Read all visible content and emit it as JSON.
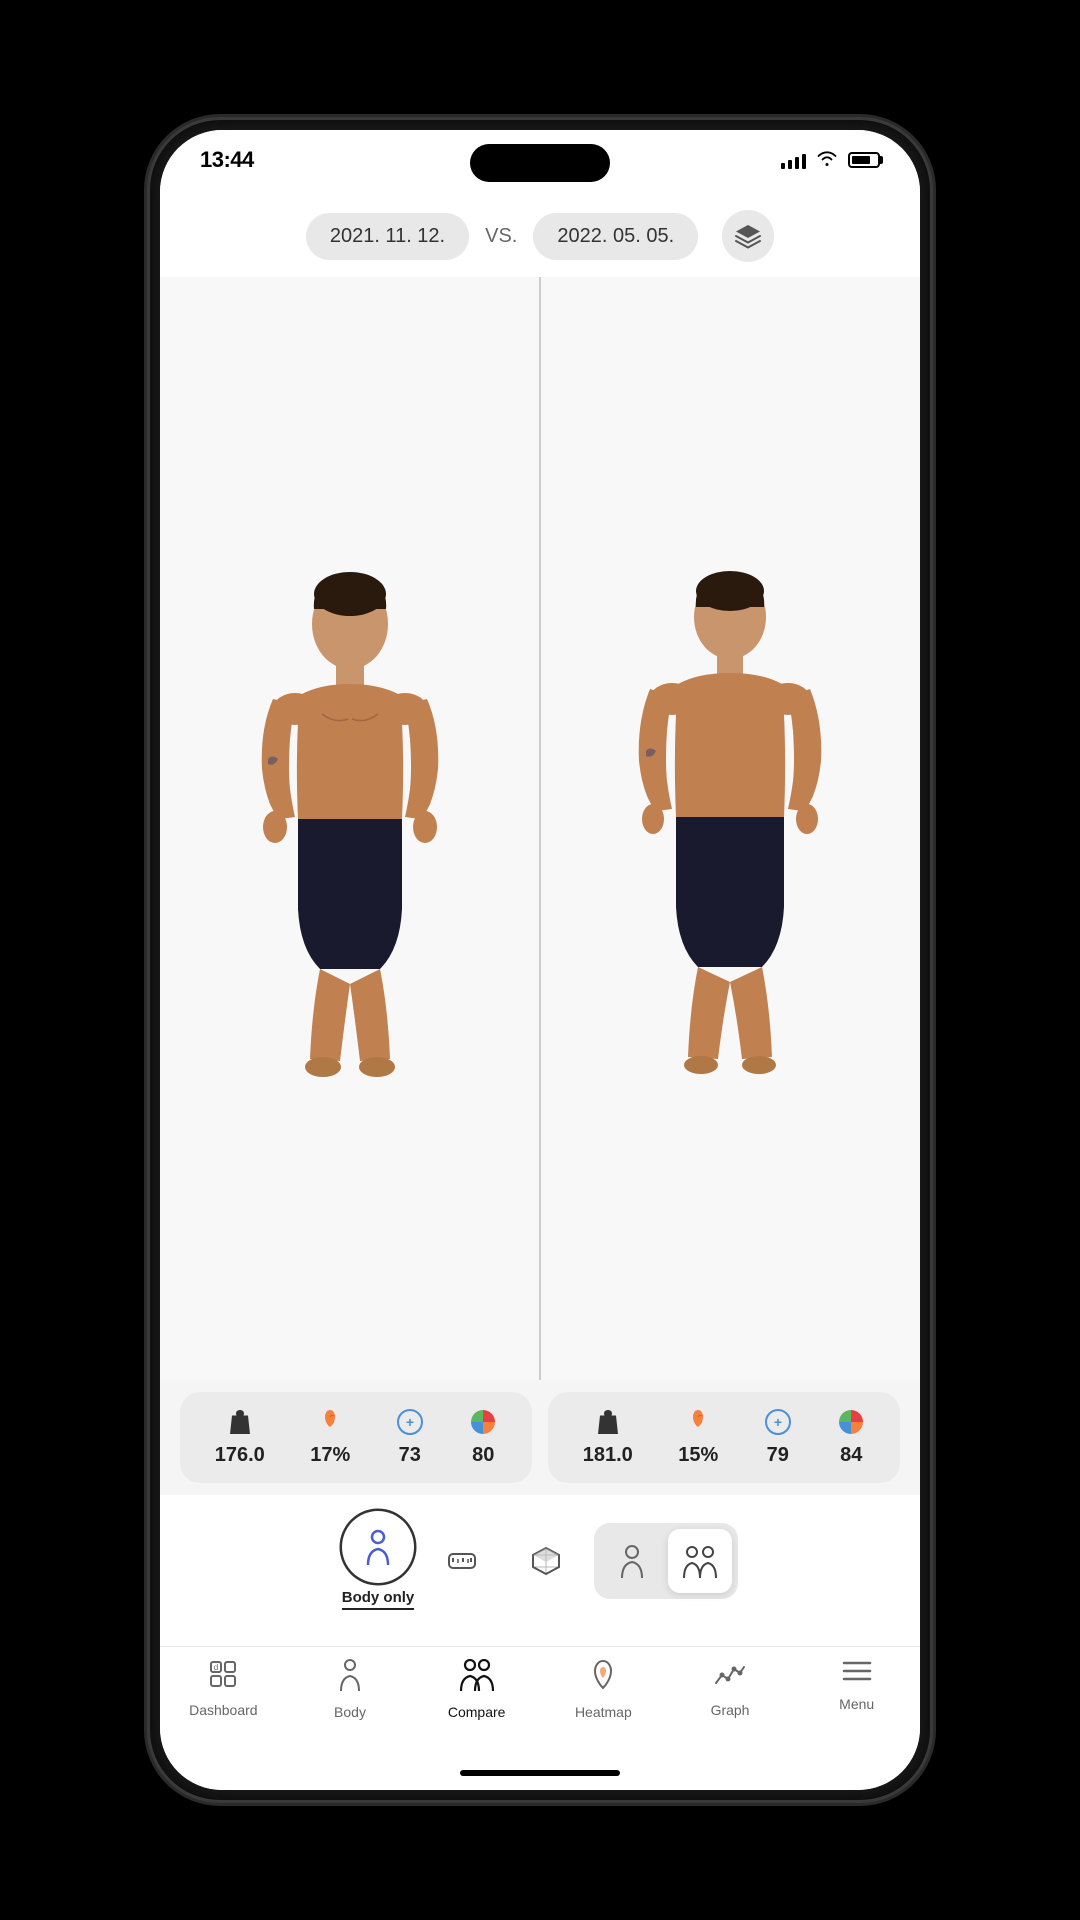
{
  "status_bar": {
    "time": "13:44",
    "signal_bars": 4,
    "wifi": true,
    "battery_percent": 75
  },
  "header": {
    "date_left": "2021. 11. 12.",
    "vs_label": "VS.",
    "date_right": "2022. 05. 05.",
    "layers_icon": "layers-icon"
  },
  "left_stats": {
    "weight": "176.0",
    "fat_percent": "17%",
    "muscle": "73",
    "score": "80"
  },
  "right_stats": {
    "weight": "181.0",
    "fat_percent": "15%",
    "muscle": "79",
    "score": "84"
  },
  "view_modes": {
    "active": "Body only",
    "modes": [
      {
        "id": "body-only",
        "label": "Body only",
        "icon": "👤"
      },
      {
        "id": "tape",
        "label": "",
        "icon": "📏"
      },
      {
        "id": "3d",
        "label": "",
        "icon": "📦"
      }
    ],
    "group_modes": [
      {
        "id": "single",
        "label": "",
        "icon": "👤"
      },
      {
        "id": "compare",
        "label": "",
        "icon": "👥"
      }
    ]
  },
  "tab_bar": {
    "tabs": [
      {
        "id": "dashboard",
        "label": "Dashboard",
        "icon": "dashboard"
      },
      {
        "id": "body",
        "label": "Body",
        "icon": "body"
      },
      {
        "id": "compare",
        "label": "Compare",
        "icon": "compare",
        "active": true
      },
      {
        "id": "heatmap",
        "label": "Heatmap",
        "icon": "heatmap"
      },
      {
        "id": "graph",
        "label": "Graph",
        "icon": "graph"
      },
      {
        "id": "menu",
        "label": "Menu",
        "icon": "menu"
      }
    ]
  },
  "colors": {
    "accent": "#4a90d9",
    "orange": "#f5813f",
    "green": "#5cb85c",
    "red": "#e84040"
  }
}
